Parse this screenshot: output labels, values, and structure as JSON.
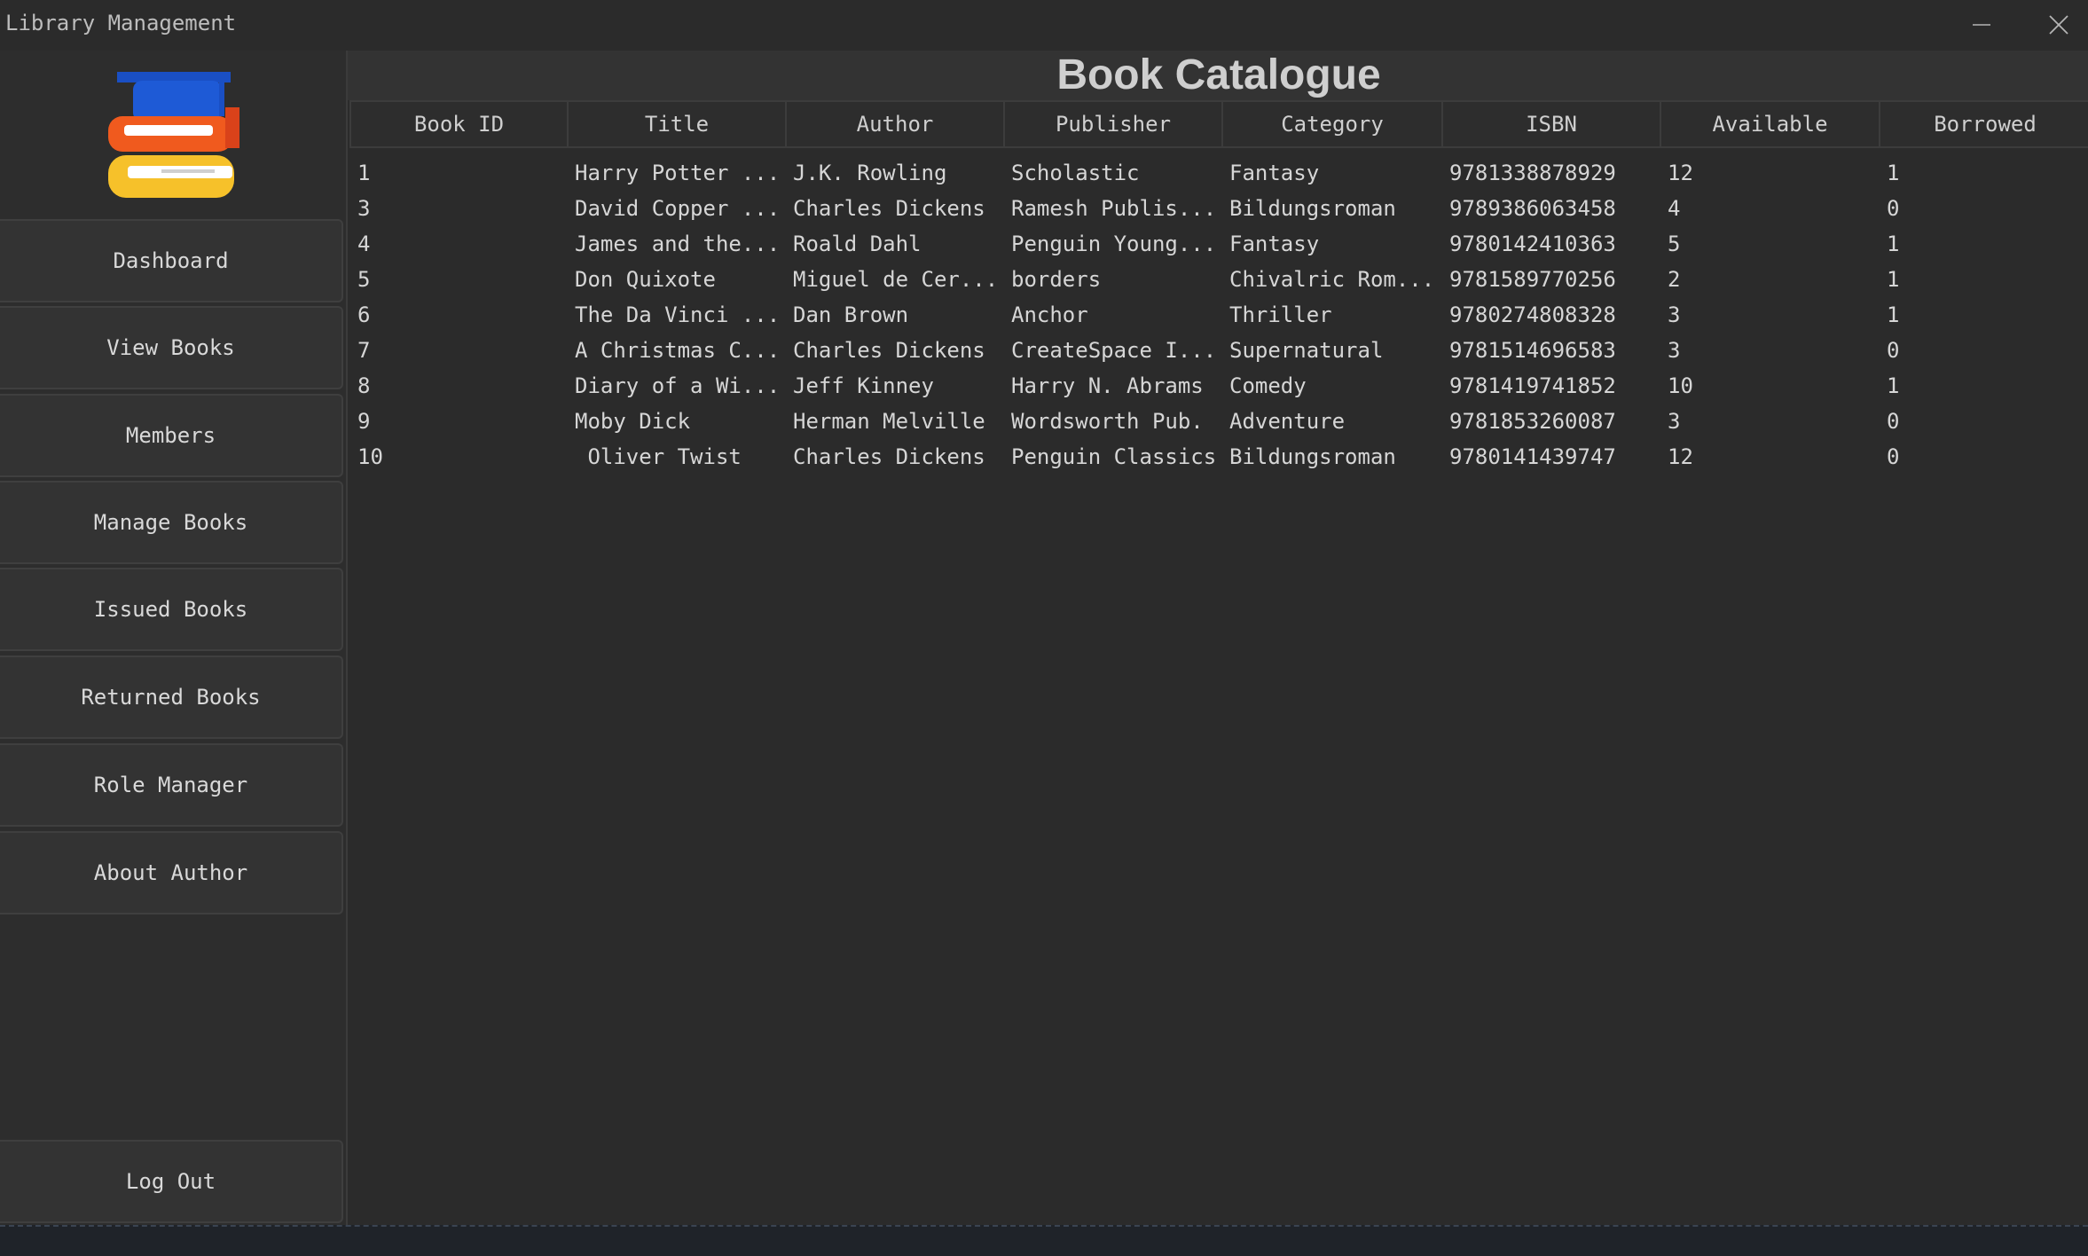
{
  "window": {
    "title": "Library Management"
  },
  "sidebar": {
    "items": [
      {
        "label": "Dashboard"
      },
      {
        "label": "View Books"
      },
      {
        "label": "Members"
      },
      {
        "label": "Manage Books"
      },
      {
        "label": "Issued Books"
      },
      {
        "label": "Returned Books"
      },
      {
        "label": "Role Manager"
      },
      {
        "label": "About Author"
      }
    ],
    "logout_label": "Log Out"
  },
  "main": {
    "title": "Book Catalogue",
    "columns": [
      "Book ID",
      "Title",
      "Author",
      "Publisher",
      "Category",
      "ISBN",
      "Available",
      "Borrowed"
    ],
    "rows": [
      [
        "1",
        "Harry Potter ...",
        "J.K. Rowling",
        "Scholastic",
        "Fantasy",
        "9781338878929",
        "12",
        "1"
      ],
      [
        "3",
        "David Copper ...",
        "Charles Dickens",
        "Ramesh Publis...",
        "Bildungsroman",
        "9789386063458",
        "4",
        "0"
      ],
      [
        "4",
        "James and the...",
        "Roald Dahl",
        "Penguin Young...",
        "Fantasy",
        "9780142410363",
        "5",
        "1"
      ],
      [
        "5",
        "Don Quixote",
        "Miguel de Cer...",
        "borders",
        "Chivalric Rom...",
        "9781589770256",
        "2",
        "1"
      ],
      [
        "6",
        "The Da Vinci ...",
        "Dan Brown",
        "Anchor",
        "Thriller",
        "9780274808328",
        "3",
        "1"
      ],
      [
        "7",
        "A Christmas C...",
        "Charles Dickens",
        "CreateSpace I...",
        "Supernatural",
        "9781514696583",
        "3",
        "0"
      ],
      [
        "8",
        "Diary of a Wi...",
        "Jeff Kinney",
        "Harry N. Abrams",
        "Comedy",
        "9781419741852",
        "10",
        "1"
      ],
      [
        "9",
        "Moby Dick",
        "Herman Melville",
        "Wordsworth Pub.",
        "Adventure",
        "9781853260087",
        "3",
        "0"
      ],
      [
        "10",
        " Oliver Twist",
        "Charles Dickens",
        "Penguin Classics",
        "Bildungsroman",
        "9780141439747",
        "12",
        "0"
      ]
    ]
  },
  "icons": {
    "minimize": "minimize-icon",
    "close": "close-icon",
    "logo": "books-graduation-cap-logo"
  },
  "colors": {
    "background": "#2b2b2b",
    "logo_blue": "#1a4fc4",
    "logo_orange": "#f05a1e",
    "logo_yellow": "#f6c12a"
  }
}
